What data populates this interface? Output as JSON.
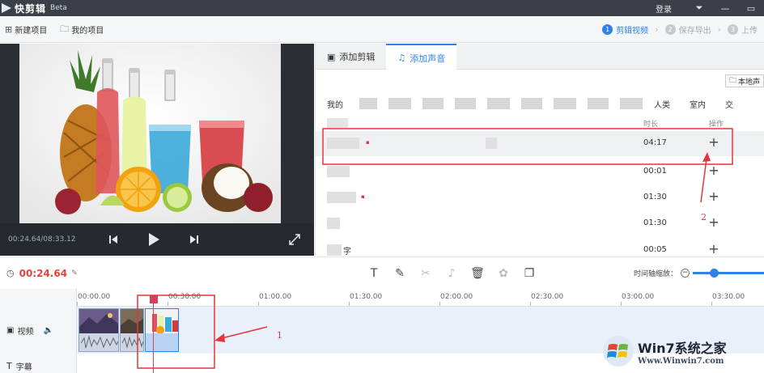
{
  "app": {
    "name": "快剪辑",
    "badge": "Beta",
    "login": "登录"
  },
  "toolbar": {
    "new_project": "新建项目",
    "my_projects": "我的项目"
  },
  "steps": [
    {
      "num": "1",
      "label": "剪辑视频"
    },
    {
      "num": "2",
      "label": "保存导出"
    },
    {
      "num": "3",
      "label": "上传"
    }
  ],
  "preview": {
    "timecode": "00:24.64/08:33.12"
  },
  "panel": {
    "tabs": [
      {
        "label": "添加剪辑"
      },
      {
        "label": "添加声音"
      }
    ],
    "local_button": "本地声",
    "category_prefix": "我的",
    "categories": [
      "人类",
      "室内",
      "交"
    ],
    "header": {
      "duration": "时长",
      "action": "操作"
    },
    "rows": [
      {
        "duration": "04:17",
        "add": "+"
      },
      {
        "duration": "00:01",
        "add": "+"
      },
      {
        "duration": "01:30",
        "add": "+"
      },
      {
        "duration": "01:30",
        "add": "+"
      },
      {
        "name_suffix": "字",
        "duration": "00:05",
        "add": "+"
      }
    ]
  },
  "edit": {
    "current_time": "00:24.64",
    "zoom_label": "时间轴缩放：",
    "zoom_level": 0.3
  },
  "timeline": {
    "ruler": [
      "00:00.00",
      "00:30.00",
      "01:00.00",
      "01:30.00",
      "02:00.00",
      "02:30.00",
      "03:00.00",
      "03:30.00"
    ],
    "video_label": "视频",
    "subtitle_label": "字幕"
  },
  "annotations": {
    "one": "1",
    "two": "2"
  },
  "watermark": {
    "title": "Win7系统之家",
    "url": "Www.Winwin7.com"
  },
  "colors": {
    "accent": "#2f83e6",
    "highlight": "#e5343c",
    "titlebar": "#3c3f47",
    "preview_bg": "#2b2e35"
  }
}
